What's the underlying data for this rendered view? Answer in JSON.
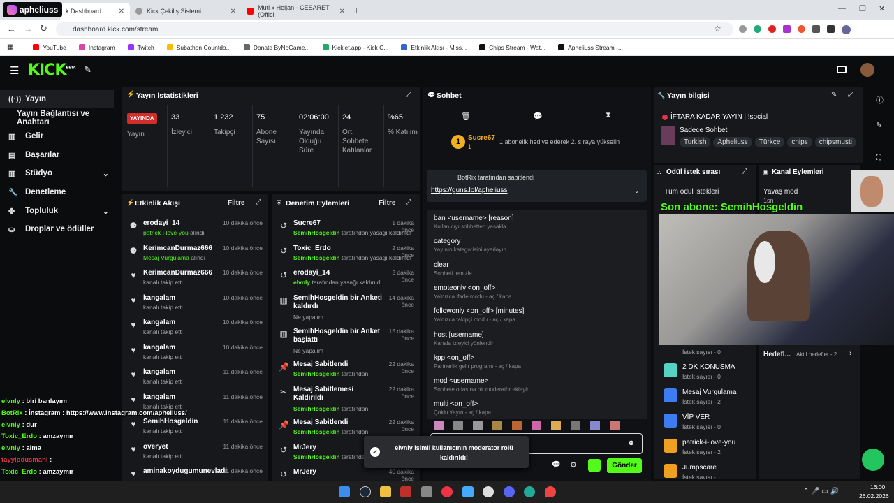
{
  "browser": {
    "tabs": [
      {
        "title": "k Dashboard",
        "active": true
      },
      {
        "title": "Kick Çekiliş Sistemi"
      },
      {
        "title": "Muti x Heijan - CESARET (Offici"
      }
    ],
    "overlay_title": "apheliuss",
    "url": "dashboard.kick.com/stream",
    "bookmarks": [
      "YouTube",
      "Instagram",
      "Twitch",
      "Subathon Countdo...",
      "Donate ByNoGame...",
      "Kicklet.app - Kick C...",
      "Etkinlik Akışı - Miss...",
      "Chips Stream - Wat...",
      "Apheliuss Stream -..."
    ]
  },
  "kick": {
    "logo": "KICK",
    "beta": "BETA"
  },
  "sidebar": [
    {
      "label": "Yayın",
      "icon": "broadcast-icon",
      "active": true
    },
    {
      "label": "Yayın Bağlantısı ve Anahtarı",
      "icon": ""
    },
    {
      "label": "Gelir",
      "icon": "bank-icon"
    },
    {
      "label": "Başarılar",
      "icon": "trophy-icon"
    },
    {
      "label": "Stüdyo",
      "icon": "studio-icon"
    },
    {
      "label": "Denetleme",
      "icon": "wrench-icon"
    },
    {
      "label": "Topluluk",
      "icon": "people-icon"
    },
    {
      "label": "Droplar ve ödüller",
      "icon": "gift-icon"
    }
  ],
  "stats": {
    "title": "Yayın İstatistikleri",
    "live": "YAYINDA",
    "live_label": "Yayın",
    "items": [
      {
        "v": "33",
        "l": "İzleyici"
      },
      {
        "v": "1.232",
        "l": "Takipçi"
      },
      {
        "v": "75",
        "l": "Abone Sayısı"
      },
      {
        "v": "02:06:00",
        "l": "Yayında Olduğu Süre"
      },
      {
        "v": "24",
        "l": "Ort. Sohbete Katılanlar"
      },
      {
        "v": "%65",
        "l": "% Katılım"
      }
    ]
  },
  "activity": {
    "title": "Etkinlik Akışı",
    "filter": "Filtre",
    "rows": [
      {
        "t": "erodayi_14",
        "s": "patrick-i-love-you",
        "s2": " alındı",
        "time": "10 dakika önce"
      },
      {
        "t": "KerimcanDurmaz666",
        "s": "Mesaj Vurgulama",
        "s2": " alındı",
        "time": "10 dakika önce"
      },
      {
        "t": "KerimcanDurmaz666",
        "s": "",
        "s2": "kanalı takip etti",
        "time": "10 dakika önce"
      },
      {
        "t": "kangalam",
        "s": "",
        "s2": "kanalı takip etti",
        "time": "10 dakika önce"
      },
      {
        "t": "kangalam",
        "s": "",
        "s2": "kanalı takip etti",
        "time": "10 dakika önce"
      },
      {
        "t": "kangalam",
        "s": "",
        "s2": "kanalı takip etti",
        "time": "10 dakika önce"
      },
      {
        "t": "kangalam",
        "s": "",
        "s2": "kanalı takip etti",
        "time": "11 dakika önce"
      },
      {
        "t": "kangalam",
        "s": "",
        "s2": "kanalı takip etti",
        "time": "11 dakika önce"
      },
      {
        "t": "SemihHosgeldin",
        "s": "",
        "s2": "kanalı takip etti",
        "time": "11 dakika önce"
      },
      {
        "t": "overyet",
        "s": "",
        "s2": "kanalı takip etti",
        "time": "11 dakika önce"
      },
      {
        "t": "aminakoydugumunevladi",
        "s": "",
        "s2": "",
        "time": "11 dakika önce"
      }
    ]
  },
  "mod": {
    "title": "Denetim Eylemleri",
    "filter": "Filtre",
    "rows": [
      {
        "t": "Sucre67",
        "s": "SemihHosgeldin",
        "s2": " tarafından yasağı kaldırıldı",
        "time": "1 dakika önce"
      },
      {
        "t": "Toxic_Erdo",
        "s": "SemihHosgeldin",
        "s2": " tarafından yasağı kaldırıldı",
        "time": "2 dakika önce"
      },
      {
        "t": "erodayi_14",
        "s": "elvnly",
        "s2": " tarafından yasağı kaldırıldı",
        "time": "3 dakika önce"
      },
      {
        "t": "SemihHosgeldin bir Anketi kaldırdı",
        "s": "",
        "s2": "Ne yapalım",
        "time": "14 dakika önce"
      },
      {
        "t": "SemihHosgeldin bir Anket başlattı",
        "s": "",
        "s2": "Ne yapalım",
        "time": "15 dakika önce"
      },
      {
        "t": "Mesaj Sabitlendi",
        "s": "SemihHosgeldin",
        "s2": " tarafından",
        "time": "22 dakika önce"
      },
      {
        "t": "Mesaj Sabitlemesi Kaldırıldı",
        "s": "SemihHosgeldin",
        "s2": " tarafından",
        "time": "22 dakika önce"
      },
      {
        "t": "Mesaj Sabitlendi",
        "s": "SemihHosgeldin",
        "s2": " tarafından",
        "time": "22 dakika önce"
      },
      {
        "t": "MrJery",
        "s": "SemihHosgeldin",
        "s2": " tarafından yasağı kaldırıldı",
        "time": "24 dakika önce"
      },
      {
        "t": "MrJery",
        "s": "",
        "s2": "",
        "time": "40 dakika önce"
      }
    ]
  },
  "chat": {
    "title": "Sohbet",
    "sub_user": "Sucre67",
    "sub_count": "1",
    "sub_text": "1 abonelik hediye ederek 2. sıraya yükselin",
    "pinned_by": "BotRix tarafından sabitlendi",
    "pinned_link": "https://guns.lol/apheliuss",
    "send": "Gönder",
    "cmds": [
      {
        "c": "ban <username> [reason]",
        "d": "Kullanıcıyı sohbetten yasakla"
      },
      {
        "c": "category",
        "d": "Yayının kategorisini ayarlayın"
      },
      {
        "c": "clear",
        "d": "Sohbeti temizle"
      },
      {
        "c": "emoteonly <on_off>",
        "d": "Yalnızca ifade modu - aç / kapa"
      },
      {
        "c": "followonly <on_off> [minutes]",
        "d": "Yalnızca takipçi modu - aç / kapa"
      },
      {
        "c": "host [username]",
        "d": "Kanala izleyici yönlendir"
      },
      {
        "c": "kpp <on_off>",
        "d": "Partnerlik gelir programı - aç / kapa"
      },
      {
        "c": "mod <username>",
        "d": "Sohbete odasına bir moderatör ekleyin"
      },
      {
        "c": "multi <on_off>",
        "d": "Çoklu Yayın - aç / kapa"
      }
    ],
    "toast": "elvnly isimli kullanıcının moderator rolü kaldırıldı!"
  },
  "info": {
    "title": "Yayın bilgisi",
    "stream_title": "İFTARA KADAR YAYIN | !social",
    "category": "Sadece Sohbet",
    "tags": [
      "Turkish",
      "Apheliuss",
      "Türkçe",
      "chips",
      "chipsmusti"
    ]
  },
  "rewards": {
    "title": "Ödül istek sırası",
    "all": "Tüm ödül istekleri",
    "items": [
      {
        "name": "2 DK KONUSMA",
        "count": "İstek sayısı - 0",
        "color": "#54d3c2"
      },
      {
        "name": "Mesaj Vurgulama",
        "count": "İstek sayısı - 2",
        "color": "#3c7cf0"
      },
      {
        "name": "VİP VER",
        "count": "İstek sayısı - 0",
        "color": "#3c7cf0"
      },
      {
        "name": "patrick-i-love-you",
        "count": "İstek sayısı - 2",
        "color": "#f0a020"
      },
      {
        "name": "Jumpscare",
        "count": "İstek sayısı -",
        "color": "#f0a020"
      }
    ],
    "first_count": "İstek sayısı - 0"
  },
  "actions": {
    "title": "Kanal Eylemleri",
    "slow": "Yavaş mod",
    "slow_val": "1sn",
    "goals": "Hedefl...",
    "goals_active": "Aktif hedefler - 2"
  },
  "overlay": {
    "banner": "Son abone: SemihHosgeldin",
    "chat": [
      {
        "u": "elvnly",
        "m": " : biri banlayım",
        "c": "#53fc18"
      },
      {
        "u": "Instagram",
        "m": " : https://www.instagram.com/apheliuss/",
        "c": "#fff"
      },
      {
        "u": "BotRix",
        "m": " : İnstagram : https://www.instagram.com/apheliuss/",
        "c": "#53fc18"
      },
      {
        "u": "elvnly",
        "m": " : dur",
        "c": "#53fc18"
      },
      {
        "u": "Toxic_Erdo",
        "m": " : amzaymır",
        "c": "#53fc18"
      },
      {
        "u": "elvnly",
        "m": " : alma",
        "c": "#53fc18"
      },
      {
        "u": "tayyipdusmani",
        "m": " : ",
        "c": "#e0344a"
      },
      {
        "u": "Toxic_Erdo",
        "m": " : amzaymır",
        "c": "#53fc18"
      },
      {
        "u": "Toxic_Erdo",
        "m": " : amzaymır",
        "c": "#53fc18"
      },
      {
        "u": "Toxic_Erdo",
        "m": " : amzaymır",
        "c": "#53fc18"
      }
    ]
  },
  "taskbar": {
    "time": "16:00",
    "date": "26.02.2026"
  }
}
